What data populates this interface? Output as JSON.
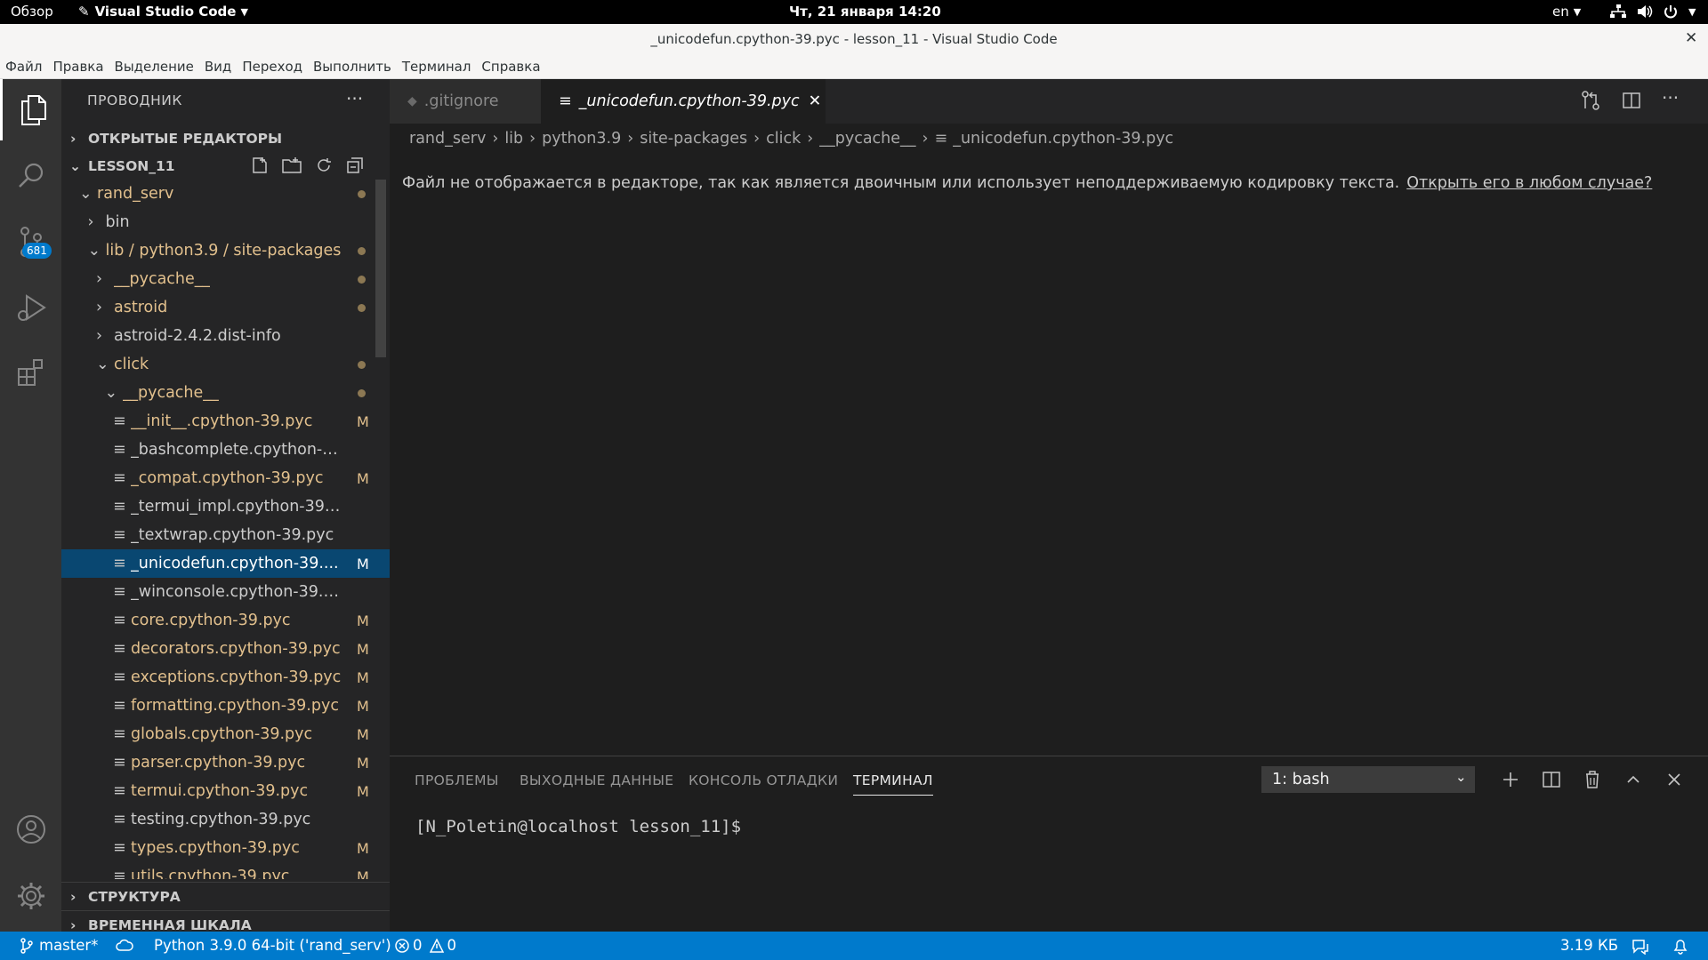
{
  "system_bar": {
    "overview": "Обзор",
    "app_name": "Visual Studio Code",
    "clock": "Чт, 21 января  14:20",
    "lang": "en"
  },
  "window": {
    "title": "_unicodefun.cpython-39.pyc - lesson_11 - Visual Studio Code",
    "close_glyph": "✕"
  },
  "menu": [
    "Файл",
    "Правка",
    "Выделение",
    "Вид",
    "Переход",
    "Выполнить",
    "Терминал",
    "Справка"
  ],
  "activity": {
    "scm_badge": "681"
  },
  "explorer": {
    "title": "ПРОВОДНИК",
    "more": "···",
    "open_editors": "ОТКРЫТЫЕ РЕДАКТОРЫ",
    "workspace": "LESSON_11",
    "tree": [
      {
        "label": "rand_serv",
        "indent": 0,
        "kind": "folder-open",
        "color": "yellow",
        "dot": true
      },
      {
        "label": "bin",
        "indent": 1,
        "kind": "folder",
        "color": "plain"
      },
      {
        "label": "lib / python3.9 / site-packages",
        "indent": 1,
        "kind": "folder-open",
        "color": "yellow",
        "dot": true
      },
      {
        "label": "__pycache__",
        "indent": 2,
        "kind": "folder",
        "color": "yellow",
        "dot": true
      },
      {
        "label": "astroid",
        "indent": 2,
        "kind": "folder",
        "color": "yellow",
        "dot": true
      },
      {
        "label": "astroid-2.4.2.dist-info",
        "indent": 2,
        "kind": "folder",
        "color": "plain"
      },
      {
        "label": "click",
        "indent": 2,
        "kind": "folder-open",
        "color": "yellow",
        "dot": true
      },
      {
        "label": "__pycache__",
        "indent": 3,
        "kind": "folder-open",
        "color": "yellow",
        "dot": true
      },
      {
        "label": "__init__.cpython-39.pyc",
        "indent": 4,
        "kind": "file",
        "color": "yellow",
        "badge": "M"
      },
      {
        "label": "_bashcomplete.cpython-39.pyc",
        "indent": 4,
        "kind": "file",
        "color": "plain"
      },
      {
        "label": "_compat.cpython-39.pyc",
        "indent": 4,
        "kind": "file",
        "color": "yellow",
        "badge": "M"
      },
      {
        "label": "_termui_impl.cpython-39.pyc",
        "indent": 4,
        "kind": "file",
        "color": "plain"
      },
      {
        "label": "_textwrap.cpython-39.pyc",
        "indent": 4,
        "kind": "file",
        "color": "plain"
      },
      {
        "label": "_unicodefun.cpython-39....",
        "indent": 4,
        "kind": "file",
        "color": "selected",
        "badge": "M",
        "selected": true
      },
      {
        "label": "_winconsole.cpython-39.pyc",
        "indent": 4,
        "kind": "file",
        "color": "plain"
      },
      {
        "label": "core.cpython-39.pyc",
        "indent": 4,
        "kind": "file",
        "color": "yellow",
        "badge": "M"
      },
      {
        "label": "decorators.cpython-39.pyc",
        "indent": 4,
        "kind": "file",
        "color": "yellow",
        "badge": "M"
      },
      {
        "label": "exceptions.cpython-39.pyc",
        "indent": 4,
        "kind": "file",
        "color": "yellow",
        "badge": "M"
      },
      {
        "label": "formatting.cpython-39.pyc",
        "indent": 4,
        "kind": "file",
        "color": "yellow",
        "badge": "M"
      },
      {
        "label": "globals.cpython-39.pyc",
        "indent": 4,
        "kind": "file",
        "color": "yellow",
        "badge": "M"
      },
      {
        "label": "parser.cpython-39.pyc",
        "indent": 4,
        "kind": "file",
        "color": "yellow",
        "badge": "M"
      },
      {
        "label": "termui.cpython-39.pyc",
        "indent": 4,
        "kind": "file",
        "color": "yellow",
        "badge": "M"
      },
      {
        "label": "testing.cpython-39.pyc",
        "indent": 4,
        "kind": "file",
        "color": "plain"
      },
      {
        "label": "types.cpython-39.pyc",
        "indent": 4,
        "kind": "file",
        "color": "yellow",
        "badge": "M"
      },
      {
        "label": "utils.cpython-39.pyc",
        "indent": 4,
        "kind": "file",
        "color": "yellow",
        "badge": "M"
      }
    ],
    "outline": "СТРУКТУРА",
    "timeline": "ВРЕМЕННАЯ ШКАЛА"
  },
  "tabs": [
    {
      "label": ".gitignore",
      "active": false
    },
    {
      "label": "_unicodefun.cpython-39.pyc",
      "active": true
    }
  ],
  "breadcrumb": [
    "rand_serv",
    "lib",
    "python3.9",
    "site-packages",
    "click",
    "__pycache__",
    "_unicodefun.cpython-39.pyc"
  ],
  "editor": {
    "message": "Файл не отображается в редакторе, так как является двоичным или использует неподдерживаемую кодировку текста.",
    "link": "Открыть его в любом случае?"
  },
  "panel": {
    "tabs": [
      "ПРОБЛЕМЫ",
      "ВЫХОДНЫЕ ДАННЫЕ",
      "КОНСОЛЬ ОТЛАДКИ",
      "ТЕРМИНАЛ"
    ],
    "active_tab": "ТЕРМИНАЛ",
    "terminal_select": "1: bash",
    "prompt": "[N_Poletin@localhost lesson_11]$"
  },
  "status": {
    "branch": "master*",
    "python": "Python 3.9.0 64-bit ('rand_serv')",
    "errors": "0",
    "warnings": "0",
    "filesize": "3.19 КБ"
  },
  "colors": {
    "accent": "#007acc",
    "selection": "#094771",
    "modified": "#e2c08d",
    "link": "#3794ff"
  }
}
